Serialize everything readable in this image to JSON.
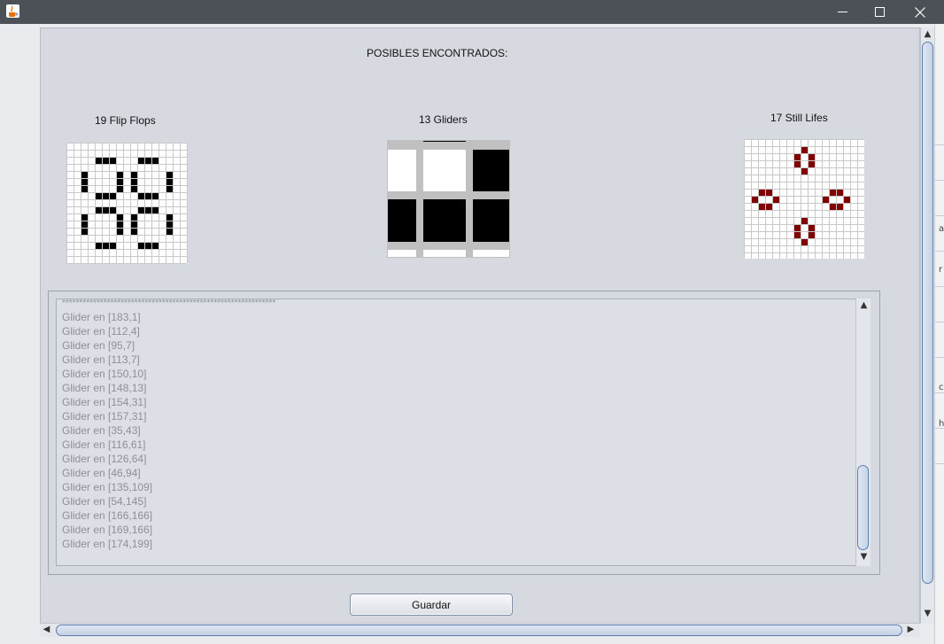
{
  "window": {
    "app_icon": "java-coffee-cup-icon",
    "controls": [
      "minimize-icon",
      "maximize-icon",
      "close-icon"
    ]
  },
  "header": {
    "title": "POSIBLES ENCONTRADOS:"
  },
  "sections": {
    "flip_flops": {
      "label": "19 Flip Flops",
      "color": "#000000"
    },
    "gliders": {
      "label": "13 Gliders",
      "color": "#000000"
    },
    "still_lifes": {
      "label": "17 Still Lifes",
      "color": "#800000"
    }
  },
  "console": {
    "separator": "**************************************************************",
    "lines": [
      "Glider en [183,1]",
      "Glider en [112,4]",
      "Glider en [95,7]",
      "Glider en [113,7]",
      "Glider en [150,10]",
      "Glider en [148,13]",
      "Glider en [154,31]",
      "Glider en [157,31]",
      "Glider en [35,43]",
      "Glider en [116,61]",
      "Glider en [126,64]",
      "Glider en [46,94]",
      "Glider en [135,109]",
      "Glider en [54,145]",
      "Glider en [166,166]",
      "Glider en [169,166]",
      "Glider en [174,199]"
    ]
  },
  "save_button": {
    "label": "Guardar"
  },
  "side_strip_chars": [
    "a",
    "r",
    "c",
    "h"
  ]
}
